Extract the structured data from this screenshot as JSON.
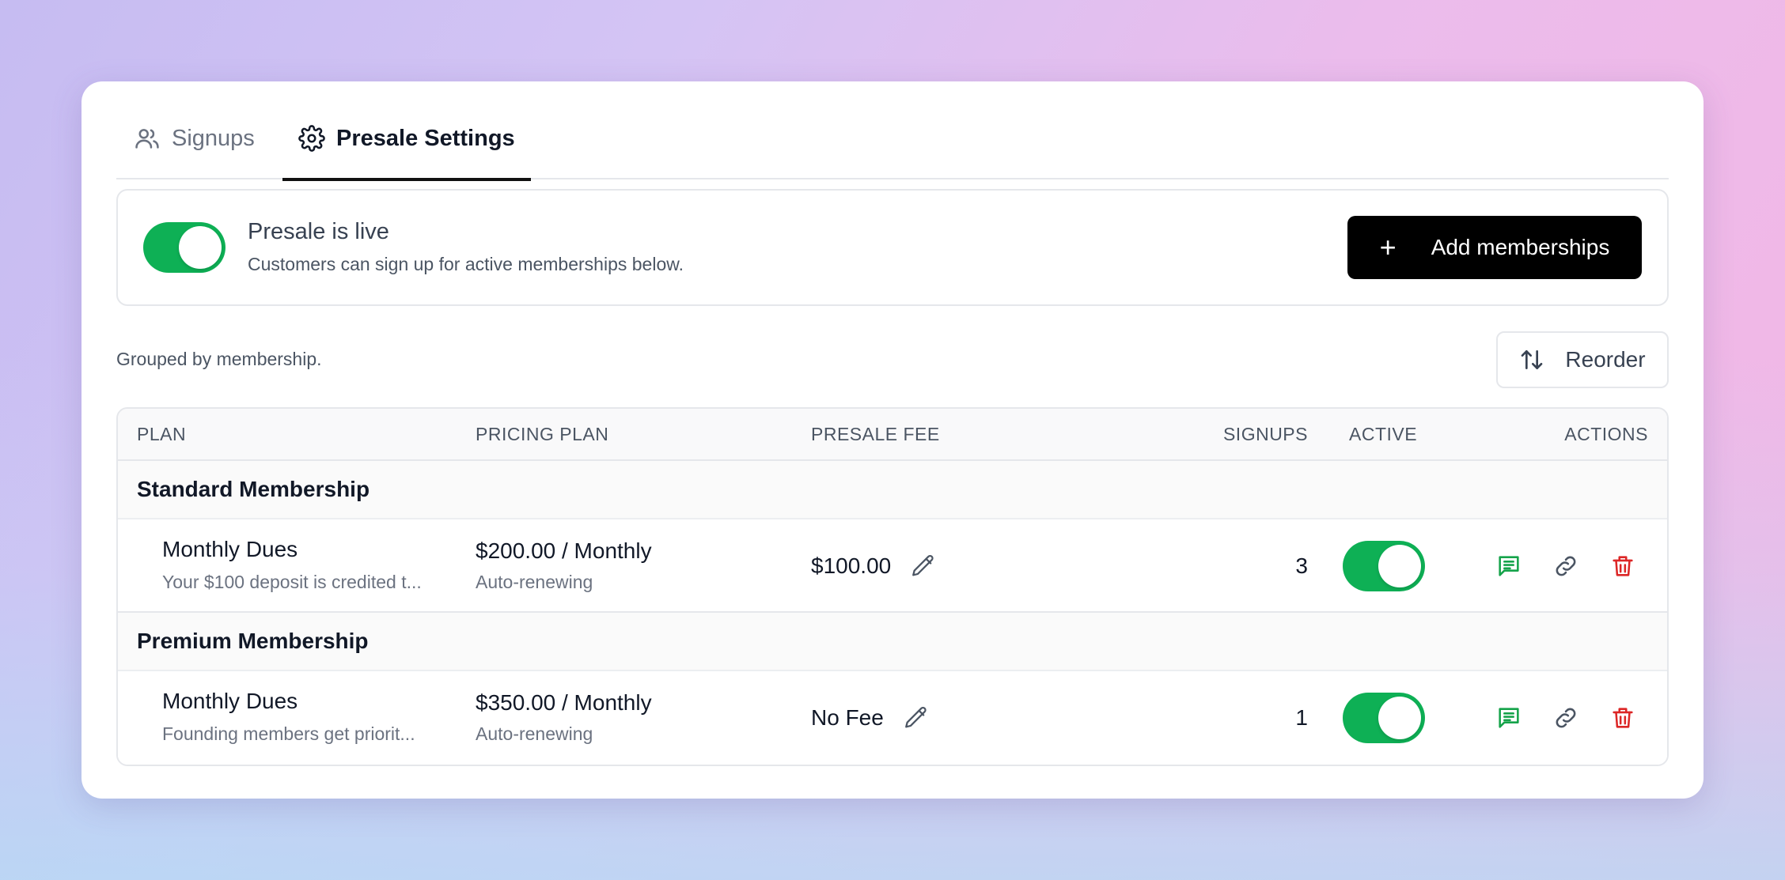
{
  "tabs": [
    {
      "label": "Signups",
      "icon": "users-icon",
      "active": false
    },
    {
      "label": "Presale Settings",
      "icon": "gear-icon",
      "active": true
    }
  ],
  "status": {
    "title": "Presale is live",
    "description": "Customers can sign up for active memberships below.",
    "enabled": true,
    "add_button": "Add memberships"
  },
  "grouping_note": "Grouped by membership.",
  "reorder_button": "Reorder",
  "table": {
    "headers": {
      "plan": "PLAN",
      "pricing_plan": "PRICING PLAN",
      "presale_fee": "PRESALE FEE",
      "signups": "SIGNUPS",
      "active": "ACTIVE",
      "actions": "ACTIONS"
    },
    "groups": [
      {
        "name": "Standard Membership",
        "rows": [
          {
            "plan": "Monthly Dues",
            "description": "Your $100 deposit is credited t...",
            "price": "$200.00 / Monthly",
            "renewal": "Auto-renewing",
            "fee": "$100.00",
            "signups": "3",
            "active": true
          }
        ]
      },
      {
        "name": "Premium Membership",
        "rows": [
          {
            "plan": "Monthly Dues",
            "description": "Founding members get priorit...",
            "price": "$350.00 / Monthly",
            "renewal": "Auto-renewing",
            "fee": "No Fee",
            "signups": "1",
            "active": true
          }
        ]
      }
    ]
  },
  "colors": {
    "toggle_on": "#0eb055",
    "message_icon": "#15a34a",
    "delete_icon": "#dc2626",
    "primary_button": "#000000"
  }
}
